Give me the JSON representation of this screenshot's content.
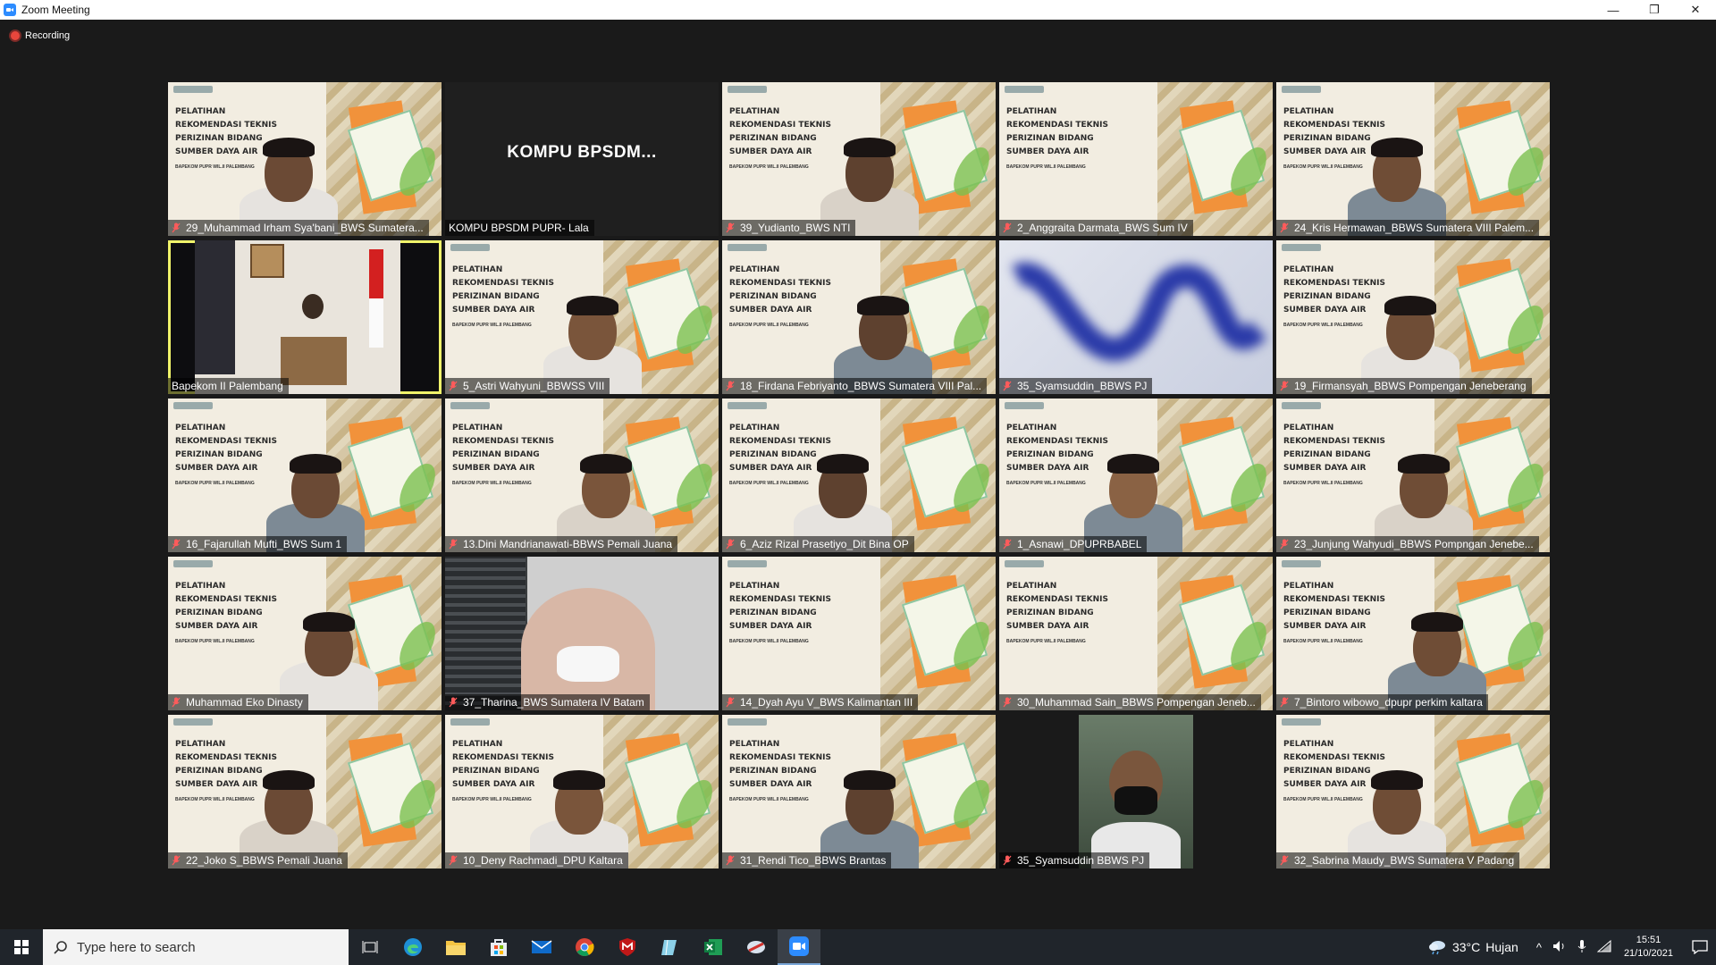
{
  "window": {
    "title": "Zoom Meeting",
    "minimize": "—",
    "restore": "❐",
    "close": "✕"
  },
  "recording": {
    "label": "Recording"
  },
  "slide": {
    "text": "PELATIHAN\nREKOMENDASI TEKNIS\nPERIZINAN BIDANG\nSUMBER DAYA AIR",
    "sub": "BAPEKOM PUPR WIL.II PALEMBANG"
  },
  "tiles": [
    {
      "name": "29_Muhammad Irham Sya'bani_BWS Sumatera...",
      "kind": "slide-person",
      "muted": true
    },
    {
      "name": "KOMPU BPSDM PUPR- Lala",
      "kind": "name-only",
      "big": "KOMPU  BPSDM...",
      "muted": false
    },
    {
      "name": "39_Yudianto_BWS NTI",
      "kind": "slide-person",
      "muted": true
    },
    {
      "name": "2_Anggraita Darmata_BWS Sum IV",
      "kind": "slide",
      "muted": true
    },
    {
      "name": "24_Kris Hermawan_BBWS Sumatera VIII Palem...",
      "kind": "slide-person",
      "muted": true
    },
    {
      "name": "Bapekom II Palembang",
      "kind": "stage",
      "muted": false,
      "active": true
    },
    {
      "name": "5_Astri Wahyuni_BBWSS VIII",
      "kind": "slide-person",
      "muted": true
    },
    {
      "name": "18_Firdana Febriyanto_BBWS Sumatera VIII Pal...",
      "kind": "slide-person",
      "muted": true
    },
    {
      "name": "35_Syamsuddin_BBWS PJ",
      "kind": "blur",
      "muted": true
    },
    {
      "name": "19_Firmansyah_BBWS Pompengan Jeneberang",
      "kind": "slide-person",
      "muted": true
    },
    {
      "name": "16_Fajarullah Mufti_BWS Sum 1",
      "kind": "slide-person",
      "muted": true
    },
    {
      "name": "13.Dini Mandrianawati-BBWS Pemali Juana",
      "kind": "slide-person",
      "muted": true
    },
    {
      "name": "6_Aziz Rizal Prasetiyo_Dit Bina OP",
      "kind": "slide-person",
      "muted": true
    },
    {
      "name": "1_Asnawi_DPUPRBABEL",
      "kind": "slide-person",
      "muted": true
    },
    {
      "name": "23_Junjung Wahyudi_BBWS Pompngan Jenebe...",
      "kind": "slide-person",
      "muted": true
    },
    {
      "name": "Muhammad Eko Dinasty",
      "kind": "slide-person",
      "muted": true
    },
    {
      "name": "37_Tharina_BWS Sumatera IV Batam",
      "kind": "room",
      "muted": true
    },
    {
      "name": "14_Dyah Ayu V_BWS Kalimantan III",
      "kind": "slide",
      "muted": true
    },
    {
      "name": "30_Muhammad Sain_BBWS Pompengan Jeneb...",
      "kind": "slide",
      "muted": true
    },
    {
      "name": "7_Bintoro wibowo_dpupr perkim kaltara",
      "kind": "slide-person",
      "muted": true
    },
    {
      "name": "22_Joko S_BBWS Pemali Juana",
      "kind": "slide-person",
      "muted": true
    },
    {
      "name": "10_Deny Rachmadi_DPU Kaltara",
      "kind": "slide-person",
      "muted": true
    },
    {
      "name": "31_Rendi Tico_BBWS Brantas",
      "kind": "slide-person",
      "muted": true
    },
    {
      "name": "35_Syamsuddin BBWS PJ",
      "kind": "portrait",
      "muted": true
    },
    {
      "name": "32_Sabrina Maudy_BWS Sumatera V Padang",
      "kind": "slide-person",
      "muted": true
    }
  ],
  "taskbar": {
    "search_placeholder": "Type here to search",
    "weather_temp": "33°C",
    "weather_desc": "Hujan",
    "time": "15:51",
    "date": "21/10/2021"
  }
}
